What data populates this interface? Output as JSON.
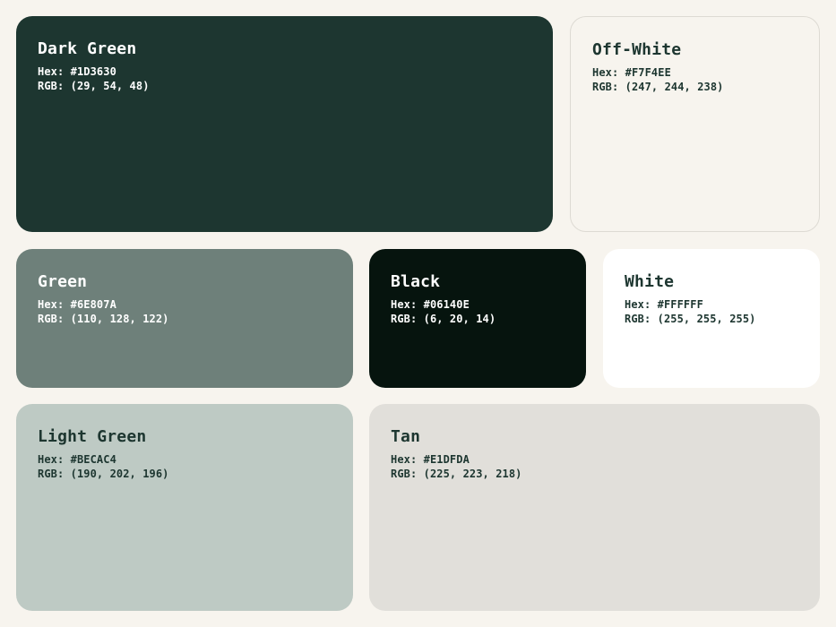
{
  "palette": {
    "dark_green": {
      "name": "Dark Green",
      "hex_label": "Hex: #1D3630",
      "rgb_label": "RGB: (29, 54, 48)",
      "color": "#1D3630"
    },
    "off_white": {
      "name": "Off-White",
      "hex_label": "Hex: #F7F4EE",
      "rgb_label": "RGB: (247, 244, 238)",
      "color": "#F7F4EE"
    },
    "green": {
      "name": "Green",
      "hex_label": "Hex: #6E807A",
      "rgb_label": "RGB: (110, 128, 122)",
      "color": "#6E807A"
    },
    "black": {
      "name": "Black",
      "hex_label": "Hex: #06140E",
      "rgb_label": "RGB: (6, 20, 14)",
      "color": "#06140E"
    },
    "white": {
      "name": "White",
      "hex_label": "Hex: #FFFFFF",
      "rgb_label": "RGB: (255, 255, 255)",
      "color": "#FFFFFF"
    },
    "light_green": {
      "name": "Light Green",
      "hex_label": "Hex: #BECAC4",
      "rgb_label": "RGB: (190, 202, 196)",
      "color": "#BECAC4"
    },
    "tan": {
      "name": "Tan",
      "hex_label": "Hex: #E1DFDA",
      "rgb_label": "RGB: (225, 223, 218)",
      "color": "#E1DFDA"
    }
  },
  "page_background": "#F7F4EE"
}
